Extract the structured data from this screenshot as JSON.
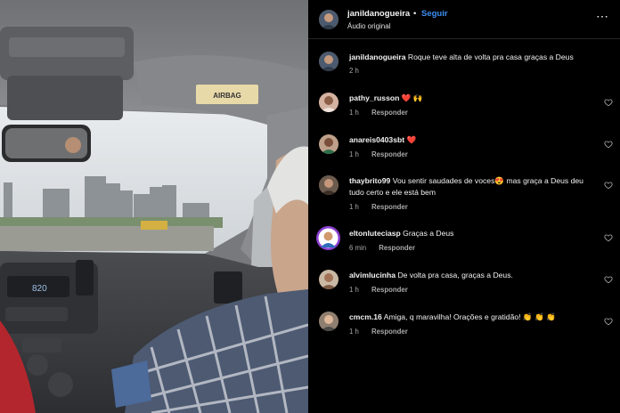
{
  "header": {
    "username": "janildanogueira",
    "dot": "•",
    "follow_label": "Seguir",
    "audio_label": "Áudio original",
    "more_icon": "more-horizontal-icon"
  },
  "video": {
    "airbag_label": "AIRBAG",
    "radio_display": "820"
  },
  "caption": {
    "username": "janildanogueira",
    "text": "Roque teve alta de volta pra casa graças a Deus",
    "time": "2 h"
  },
  "comments": [
    {
      "username": "pathy_russon",
      "text": " ❤️ 🙌",
      "time": "1 h",
      "reply_label": "Responder"
    },
    {
      "username": "anareis0403sbt",
      "text": " ❤️",
      "time": "1 h",
      "reply_label": "Responder"
    },
    {
      "username": "thaybrito99",
      "text": " Vou sentir saudades de voces😍 mas graça a Deus deu tudo certo e ele está bem",
      "time": "1 h",
      "reply_label": "Responder"
    },
    {
      "username": "eltonluteciasp",
      "text": " Graças a Deus",
      "time": "6 min",
      "reply_label": "Responder"
    },
    {
      "username": "alvimlucinha",
      "text": " De volta pra casa, graças a Deus.",
      "time": "1 h",
      "reply_label": "Responder"
    },
    {
      "username": "cmcm.16",
      "text": " Amiga, q maravilha! Orações e gratidão! 👏 👏 👏",
      "time": "1 h",
      "reply_label": "Responder"
    }
  ],
  "colors": {
    "follow": "#3d8ef2",
    "meta": "#a8a8a8",
    "heart_emoji": "#ff3040"
  }
}
